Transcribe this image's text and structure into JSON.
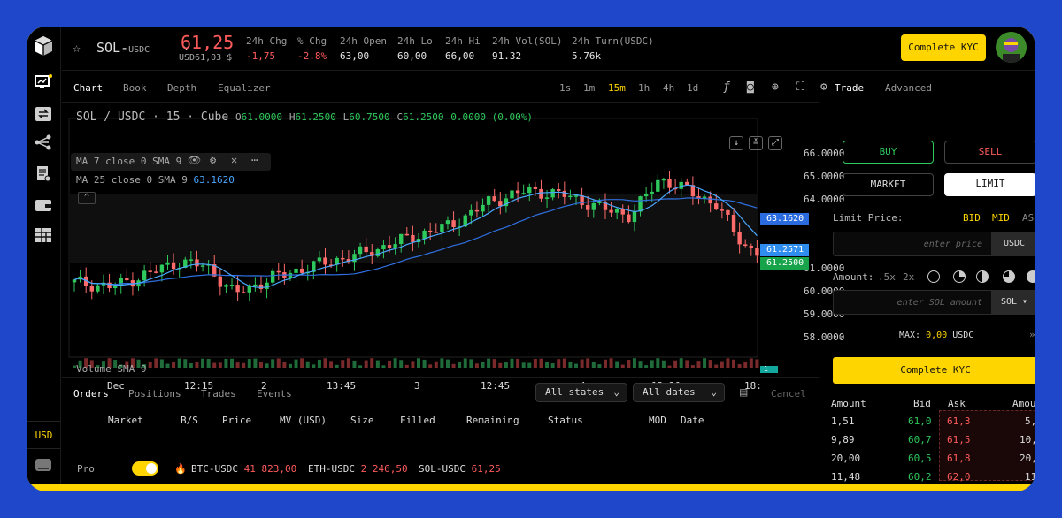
{
  "header": {
    "pair": "SOL-",
    "pair_quote": "USDC",
    "last_price": "61,25",
    "last_price_usd": "USD61,03 $",
    "stats": [
      {
        "label": "24h Chg",
        "value": "-1,75",
        "color": "#ff5b5b"
      },
      {
        "label": "% Chg",
        "value": "-2.8%",
        "color": "#ff5b5b"
      },
      {
        "label": "24h Open",
        "value": "63,00"
      },
      {
        "label": "24h Lo",
        "value": "60,00"
      },
      {
        "label": "24h Hi",
        "value": "66,00"
      },
      {
        "label": "24h Vol(SOL)",
        "value": "91.32"
      },
      {
        "label": "24h Turn(USDC)",
        "value": "5.76k"
      }
    ],
    "kyc_button": "Complete KYC"
  },
  "rail": {
    "currency": "USD"
  },
  "chart_tabs": [
    "Chart",
    "Book",
    "Depth",
    "Equalizer"
  ],
  "timeframes": [
    "1s",
    "1m",
    "15m",
    "1h",
    "4h",
    "1d"
  ],
  "active_timeframe": "15m",
  "chart_legend": {
    "symbol": "SOL / USDC · 15 · Cube",
    "o": "61.0000",
    "h": "61.2500",
    "l": "60.7500",
    "c": "61.2500",
    "change": "0.0000 (0.00%)",
    "ma7": "MA 7 close 0 SMA 9",
    "ma25": "MA 25 close 0 SMA 9",
    "ma25_value": "63.1620",
    "volume": "Volume SMA 9",
    "volume_value": "1"
  },
  "price_tags": [
    "63.1620",
    "61.2571",
    "61.2500"
  ],
  "chart_data": {
    "type": "candlestick",
    "x_ticks": [
      "Dec",
      "12:15",
      "2",
      "13:45",
      "3",
      "12:45",
      "4",
      "12:30",
      "18:"
    ],
    "y_ticks": [
      "66.0000",
      "65.0000",
      "64.0000",
      "61.0000",
      "60.0000",
      "59.0000",
      "58.0000"
    ],
    "ylim": [
      57.5,
      66.5
    ],
    "up_color": "#2ec95c",
    "down_color": "#ff6b6b",
    "ma_colors": [
      "#4aa8ff",
      "#4aa8ff"
    ]
  },
  "orders": {
    "tabs": [
      "Orders",
      "Positions",
      "Trades",
      "Events"
    ],
    "states_filter": "All states",
    "dates_filter": "All dates",
    "cancel": "Cancel",
    "columns": [
      "Market",
      "B/S",
      "Price",
      "MV (USD)",
      "Size",
      "Filled",
      "Remaining",
      "Status",
      "MOD",
      "Date"
    ]
  },
  "footer": {
    "pro": "Pro",
    "tickers": [
      {
        "pair": "BTC-USDC",
        "price": "41 823,00"
      },
      {
        "pair": "ETH-USDC",
        "price": "2 246,50"
      },
      {
        "pair": "SOL-USDC",
        "price": "61,25"
      }
    ]
  },
  "trade": {
    "tabs": [
      "Trade",
      "Advanced"
    ],
    "buy": "BUY",
    "sell": "SELL",
    "market": "MARKET",
    "limit": "LIMIT",
    "limit_price_label": "Limit Price:",
    "bid": "BID",
    "mid": "MID",
    "ask": "ASK",
    "limit_placeholder": "enter price",
    "limit_unit": "USDC",
    "amount_label": "Amount:",
    "amount_chips": [
      ".5x",
      "2x"
    ],
    "amount_placeholder": "enter SOL amount",
    "amount_unit": "SOL",
    "max_label": "MAX:",
    "max_value": "0,00",
    "max_unit": "USDC",
    "kyc_button": "Complete KYC"
  },
  "orderbook": {
    "headers": [
      "Amount",
      "Bid",
      "Ask",
      "Amou"
    ],
    "rows": [
      {
        "amount": "1,51",
        "bid": "61,0",
        "ask": "61,3",
        "amount2": "5,"
      },
      {
        "amount": "9,89",
        "bid": "60,7",
        "ask": "61,5",
        "amount2": "10,"
      },
      {
        "amount": "20,00",
        "bid": "60,5",
        "ask": "61,8",
        "amount2": "20,"
      },
      {
        "amount": "11,48",
        "bid": "60,2",
        "ask": "62,0",
        "amount2": "11"
      }
    ]
  }
}
